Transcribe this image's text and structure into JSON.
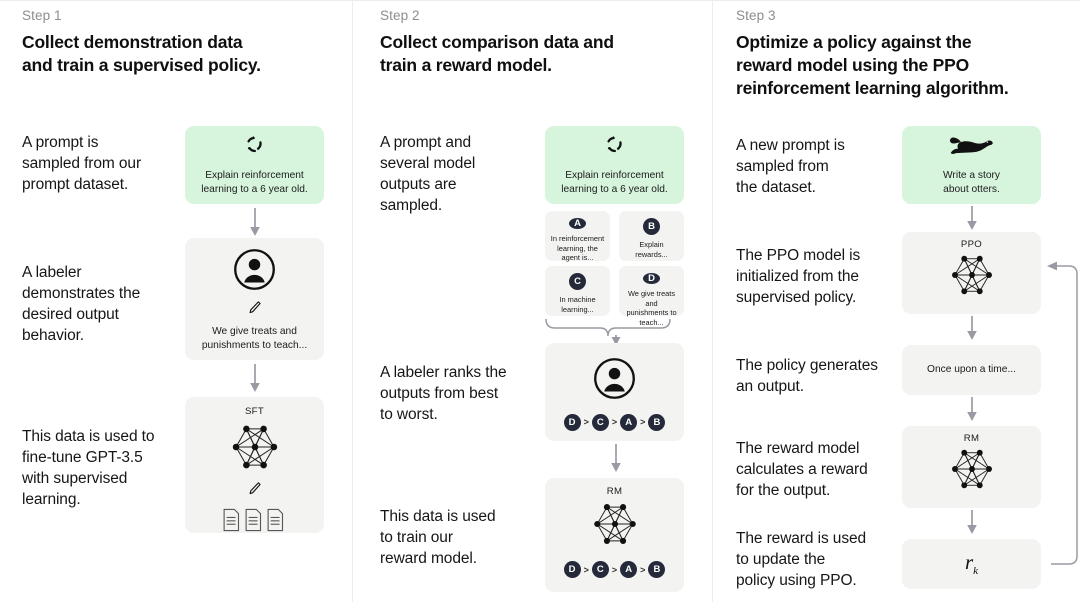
{
  "meta": {
    "accent_green": "#d7f5dd",
    "card_gray": "#f3f3f1",
    "badge_navy": "#252a3a",
    "arrow_gray": "#9a9aa4",
    "divider": "#ededed"
  },
  "columns": [
    {
      "step_label": "Step 1",
      "title_line1": "Collect demonstration data",
      "title_line2": "and train a supervised policy.",
      "paragraphs": [
        "A prompt is\nsampled from our\nprompt dataset.",
        "A labeler\ndemonstrates the\ndesired output\nbehavior.",
        "This data is used to\nfine-tune GPT-3.5\nwith supervised\nlearning."
      ],
      "cards": [
        {
          "kind": "prompt-green",
          "icon": "refresh-cycle-icon",
          "caption": "Explain reinforcement\nlearning to a 6 year old."
        },
        {
          "kind": "labeler",
          "icon": "person-circle-icon",
          "sub_icon": "pencil-icon",
          "caption": "We give treats and\npunishments to teach..."
        },
        {
          "kind": "model-docs",
          "model_label": "SFT",
          "icon": "neural-network-icon",
          "sub_icon": "pencil-icon",
          "docs_icon": "documents-icon"
        }
      ]
    },
    {
      "step_label": "Step 2",
      "title_line1": "Collect comparison data and",
      "title_line2": "train a reward model.",
      "paragraphs": [
        "A prompt and\nseveral model\noutputs are\nsampled.",
        "A labeler ranks the\noutputs from best\nto worst.",
        "This data is used\nto train our\nreward model."
      ],
      "cards": [
        {
          "kind": "prompt-green",
          "icon": "refresh-cycle-icon",
          "caption": "Explain reinforcement\nlearning to a 6 year old."
        },
        {
          "kind": "labeler-rank",
          "icon": "person-circle-icon",
          "ranking": [
            "D",
            "C",
            "A",
            "B"
          ]
        },
        {
          "kind": "model-rank",
          "model_label": "RM",
          "icon": "neural-network-icon",
          "ranking": [
            "D",
            "C",
            "A",
            "B"
          ]
        }
      ],
      "options": [
        {
          "badge": "A",
          "text": "In reinforcement\nlearning, the\nagent is..."
        },
        {
          "badge": "B",
          "text": "Explain rewards..."
        },
        {
          "badge": "C",
          "text": "In machine\nlearning..."
        },
        {
          "badge": "D",
          "text": "We give treats and\npunishments to\nteach..."
        }
      ]
    },
    {
      "step_label": "Step 3",
      "title_line1": "Optimize a policy against the",
      "title_line2": "reward model using the PPO",
      "title_line3": "reinforcement learning algorithm.",
      "paragraphs": [
        "A new prompt is\nsampled from\nthe dataset.",
        "The PPO model is\ninitialized from the\nsupervised policy.",
        "The policy generates\nan output.",
        "The reward model\ncalculates a reward\nfor the output.",
        "The reward is used\nto update the\npolicy using PPO."
      ],
      "cards": [
        {
          "kind": "prompt-green-otter",
          "icon": "otter-icon",
          "caption": "Write a story\nabout otters."
        },
        {
          "kind": "model",
          "model_label": "PPO",
          "icon": "neural-network-icon"
        },
        {
          "kind": "output-text",
          "caption": "Once upon a time..."
        },
        {
          "kind": "model",
          "model_label": "RM",
          "icon": "neural-network-icon"
        },
        {
          "kind": "reward",
          "caption": "r",
          "subscript": "k"
        }
      ],
      "loop": {
        "name": "feedback-loop-arrow"
      }
    }
  ]
}
